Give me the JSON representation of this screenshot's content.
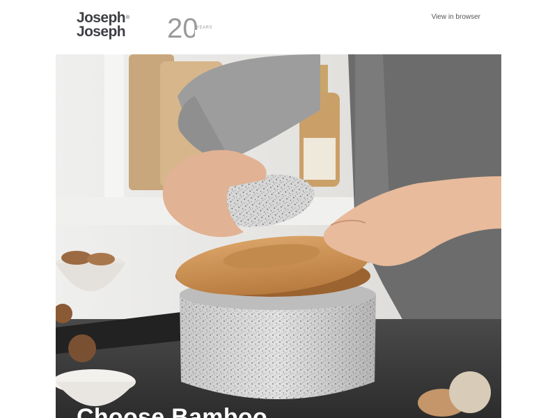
{
  "header": {
    "brand_line1": "Joseph",
    "brand_line2": "Joseph",
    "brand_reg": "®",
    "anniversary_number": "20",
    "anniversary_word": "YEARS",
    "view_in_browser": "View in browser"
  },
  "hero": {
    "title": "Choose Bamboo"
  },
  "colors": {
    "brand_text": "#3d3f43",
    "anniversary_grey": "#9a9a9a"
  },
  "icons": {
    "logo": "joseph-joseph-logo",
    "anniversary": "20-years-logo"
  }
}
